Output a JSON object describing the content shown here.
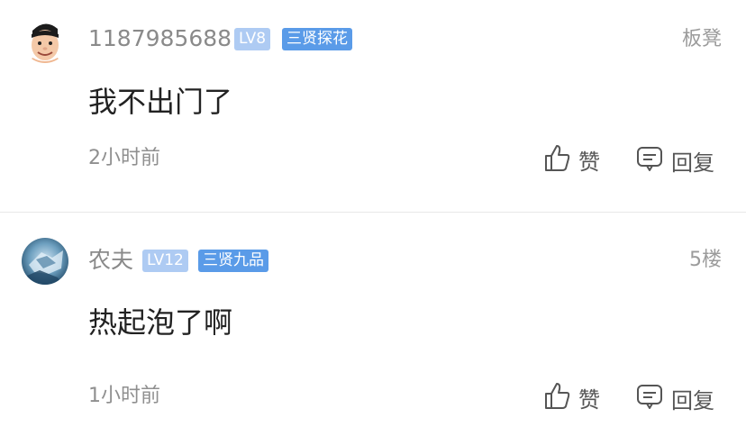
{
  "comments": [
    {
      "username": "1187985688",
      "level": "LV8",
      "title": "三贤探花",
      "floor": "板凳",
      "content": "我不出门了",
      "time": "2小时前",
      "like_label": "赞",
      "reply_label": "回复",
      "avatar_icon": "cartoon-face-avatar"
    },
    {
      "username": "农夫",
      "level": "LV12",
      "title": "三贤九品",
      "floor": "5楼",
      "content": "热起泡了啊",
      "time": "1小时前",
      "like_label": "赞",
      "reply_label": "回复",
      "avatar_icon": "blue-ice-avatar"
    }
  ],
  "colors": {
    "level_badge_bg": "#aecbf3",
    "title_badge_bg": "#5a9be8",
    "username": "#8a8a8a",
    "content": "#222222",
    "divider": "#e8e8e8"
  }
}
